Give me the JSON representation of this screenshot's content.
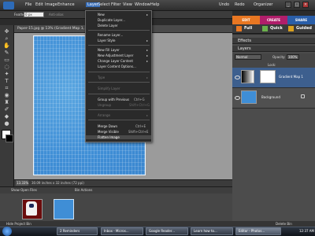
{
  "menubar": {
    "items": [
      "File",
      "Edit",
      "Image",
      "Enhance",
      "Layer",
      "Select",
      "Filter",
      "View",
      "Window",
      "Help"
    ],
    "undo": "Undo",
    "redo": "Redo",
    "organizer": "Organizer"
  },
  "options": {
    "feather_label": "Feather:",
    "feather_value": "0 px",
    "antialias_label": "Anti-alias"
  },
  "mode_tabs": [
    "EDIT",
    "CREATE",
    "SHARE"
  ],
  "edit_subtabs": [
    "Full",
    "Quick",
    "Guided"
  ],
  "document": {
    "title": "Paper-15.jpg @ 13% (Gradient Map 1, Layer Mask/8)",
    "zoom": "13.33%",
    "info": "30.09 inches x 32 inches (72 ppi)"
  },
  "layer_menu": {
    "items": [
      {
        "label": "New",
        "disabled": false,
        "submenu": true
      },
      {
        "label": "Duplicate Layer...",
        "disabled": false
      },
      {
        "label": "Delete Layer",
        "disabled": false
      },
      {
        "label": "Rename Layer...",
        "disabled": false
      },
      {
        "label": "Layer Style",
        "disabled": false,
        "submenu": true
      },
      {
        "label": "New Fill Layer",
        "disabled": false,
        "submenu": true
      },
      {
        "label": "New Adjustment Layer",
        "disabled": false,
        "submenu": true
      },
      {
        "label": "Change Layer Content",
        "disabled": false,
        "submenu": true
      },
      {
        "label": "Layer Content Options...",
        "disabled": false
      },
      {
        "label": "Type",
        "disabled": true,
        "submenu": true
      },
      {
        "label": "Simplify Layer",
        "disabled": true
      },
      {
        "label": "Group with Previous",
        "disabled": false,
        "shortcut": "Ctrl+G"
      },
      {
        "label": "Ungroup",
        "disabled": true,
        "shortcut": "Shift+Ctrl+G"
      },
      {
        "label": "Arrange",
        "disabled": true,
        "submenu": true
      },
      {
        "label": "Merge Down",
        "disabled": false,
        "shortcut": "Ctrl+E"
      },
      {
        "label": "Merge Visible",
        "disabled": false,
        "shortcut": "Shift+Ctrl+E"
      },
      {
        "label": "Flatten Image",
        "disabled": false,
        "highlighted": true
      }
    ]
  },
  "panels": {
    "effects": "Effects",
    "layers": "Layers",
    "blend_mode": "Normal",
    "opacity_label": "Opacity:",
    "opacity_value": "100%",
    "lock_label": "Lock:",
    "layers_list": [
      {
        "name": "Gradient Map 1",
        "selected": true
      },
      {
        "name": "Background",
        "selected": false,
        "locked": true
      }
    ]
  },
  "bin": {
    "show_open_files": "Show Open Files",
    "bin_actions": "Bin Actions",
    "hide_project_bin": "Hide Project Bin",
    "delete_bin": "Delete Bin"
  },
  "taskbar": {
    "buttons": [
      "2 Reminders",
      "Inbox - Micros...",
      "Google Reader...",
      "Learn how to...",
      "Editor - Photos..."
    ],
    "active_index": 4,
    "clock": "12:37 AM"
  },
  "colors": {
    "edit_tab": "#e87722",
    "create_tab": "#b01e6a",
    "share_tab": "#2a5ea8",
    "canvas_blue": "#3f8ed6"
  },
  "icons": {
    "tools": [
      "move-tool-icon",
      "zoom-tool-icon",
      "hand-tool-icon",
      "eyedropper-tool-icon",
      "marquee-tool-icon",
      "lasso-tool-icon",
      "magic-wand-tool-icon",
      "quick-selection-tool-icon",
      "type-tool-icon",
      "crop-tool-icon",
      "cookie-cutter-tool-icon",
      "straighten-tool-icon",
      "red-eye-tool-icon",
      "healing-brush-tool-icon",
      "clone-stamp-tool-icon",
      "eraser-tool-icon",
      "brush-tool-icon",
      "smart-brush-tool-icon",
      "paint-bucket-tool-icon",
      "gradient-tool-icon",
      "shape-tool-icon",
      "blur-tool-icon",
      "sponge-tool-icon"
    ]
  }
}
